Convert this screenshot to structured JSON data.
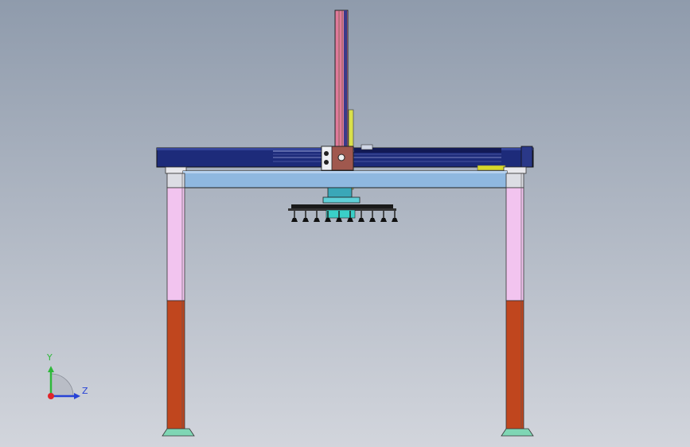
{
  "viewport": {
    "background_top": "#8f9bac",
    "background_bottom": "#d2d5dc"
  },
  "triad": {
    "y_label": "Y",
    "z_label": "Z",
    "x_color": "#e0242a",
    "y_color": "#2fb83a",
    "z_color": "#2742d6"
  },
  "model": {
    "name": "gantry-robot",
    "colors": {
      "beam": "#1d2b7a",
      "cross_beam": "#8fb8e0",
      "leg_upper": "#f2c4ef",
      "leg_lower": "#c0461e",
      "vertical_axis": "#d86a8a",
      "base_plate": "#7fd6b4",
      "gripper_plate": "#3aa7b8",
      "yellow_cable": "#d9e04a"
    }
  }
}
